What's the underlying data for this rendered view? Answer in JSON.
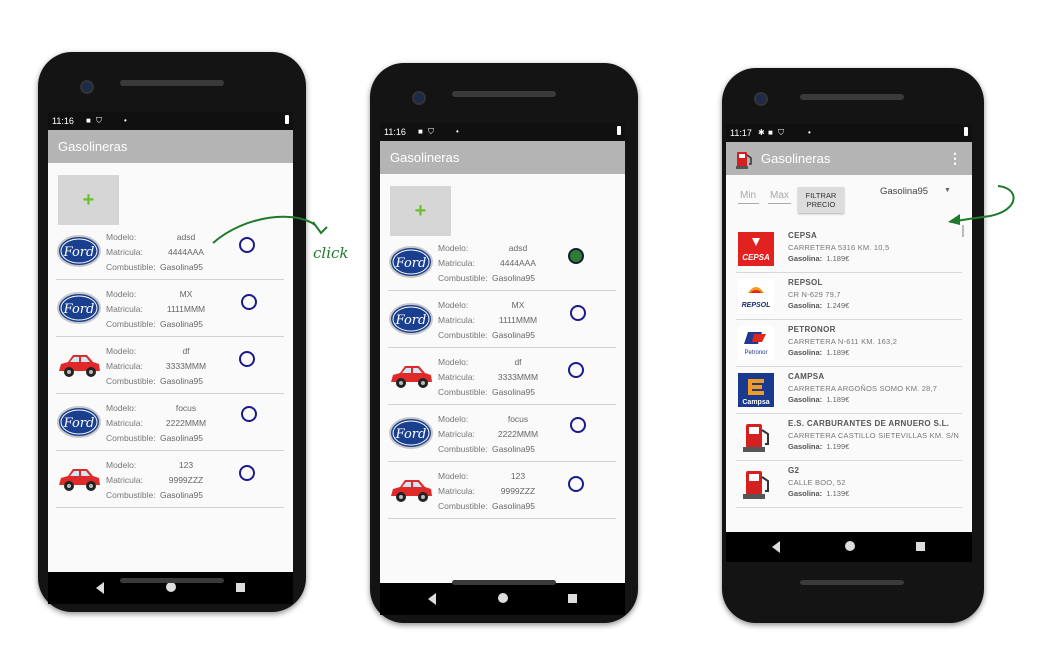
{
  "screens": [
    {
      "status_time": "11:16",
      "title": "Gasolineras",
      "add_label": "+",
      "labels": {
        "model": "Modelo:",
        "plate": "Matricula:",
        "fuel": "Combustible:"
      },
      "cars": [
        {
          "logo": "ford",
          "model": "adsd",
          "plate": "4444AAA",
          "fuel": "Gasolina95",
          "selected": false
        },
        {
          "logo": "ford",
          "model": "MX",
          "plate": "1111MMM",
          "fuel": "Gasolina95",
          "selected": false
        },
        {
          "logo": "red-car",
          "model": "df",
          "plate": "3333MMM",
          "fuel": "Gasolina95",
          "selected": false
        },
        {
          "logo": "ford",
          "model": "focus",
          "plate": "2222MMM",
          "fuel": "Gasolina95",
          "selected": false
        },
        {
          "logo": "red-car",
          "model": "123",
          "plate": "9999ZZZ",
          "fuel": "Gasolina95",
          "selected": false
        }
      ]
    },
    {
      "status_time": "11:16",
      "title": "Gasolineras",
      "add_label": "+",
      "labels": {
        "model": "Modelo:",
        "plate": "Matricula:",
        "fuel": "Combustible:"
      },
      "cars": [
        {
          "logo": "ford",
          "model": "adsd",
          "plate": "4444AAA",
          "fuel": "Gasolina95",
          "selected": true
        },
        {
          "logo": "ford",
          "model": "MX",
          "plate": "1111MMM",
          "fuel": "Gasolina95",
          "selected": false
        },
        {
          "logo": "red-car",
          "model": "df",
          "plate": "3333MMM",
          "fuel": "Gasolina95",
          "selected": false
        },
        {
          "logo": "ford",
          "model": "focus",
          "plate": "2222MMM",
          "fuel": "Gasolina95",
          "selected": false
        },
        {
          "logo": "red-car",
          "model": "123",
          "plate": "9999ZZZ",
          "fuel": "Gasolina95",
          "selected": false
        }
      ]
    },
    {
      "status_time": "11:17",
      "title": "Gasolineras",
      "filter": {
        "min_placeholder": "Min",
        "max_placeholder": "Max",
        "button_line1": "FILTRAR",
        "button_line2": "PRECIO",
        "fuel_selected": "Gasolina95"
      },
      "price_label": "Gasolina:",
      "stations": [
        {
          "logo": "cepsa",
          "name": "CEPSA",
          "address": "CARRETERA 5316 KM. 10,5",
          "price": "1.189€"
        },
        {
          "logo": "repsol",
          "name": "REPSOL",
          "address": "CR N-629 79,7",
          "price": "1.249€"
        },
        {
          "logo": "petronor",
          "name": "PETRONOR",
          "address": "CARRETERA N-611 KM. 163,2",
          "price": "1.189€"
        },
        {
          "logo": "campsa",
          "name": "CAMPSA",
          "address": "CARRETERA ARGOÑOS SOMO KM. 28,7",
          "price": "1.189€"
        },
        {
          "logo": "fuel-pump",
          "name": "E.S. CARBURANTES DE ARNUERO S.L.",
          "address": "CARRETERA CASTILLO SIETEVILLAS KM. S/N",
          "price": "1.199€"
        },
        {
          "logo": "fuel-pump",
          "name": "G2",
          "address": "CALLE BOO, 52",
          "price": "1.139€"
        }
      ]
    }
  ],
  "annotation": {
    "click_text": "click"
  },
  "logo_text": {
    "ford": "Ford",
    "cepsa": "CEPSA",
    "repsol": "REPSOL",
    "petronor": "Petronor",
    "campsa": "Campsa"
  },
  "colors": {
    "appbar": "#b4b4b4",
    "accent_green": "#6bc12d",
    "radio_blue": "#1a1a8c",
    "annotation_green": "#1f7a2c"
  }
}
